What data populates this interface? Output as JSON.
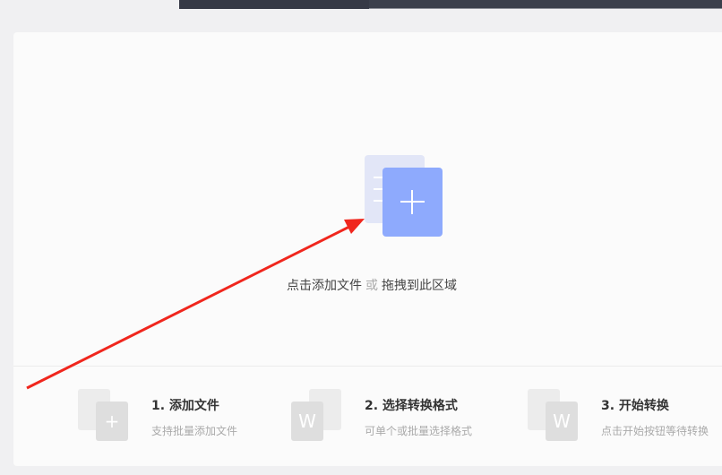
{
  "upload": {
    "hint_main": "点击添加文件",
    "hint_or": "或",
    "hint_drag": "拖拽到此区域"
  },
  "steps": [
    {
      "title": "1. 添加文件",
      "desc": "支持批量添加文件",
      "glyph": "+"
    },
    {
      "title": "2. 选择转换格式",
      "desc": "可单个或批量选择格式",
      "glyph": "W"
    },
    {
      "title": "3. 开始转换",
      "desc": "点击开始按钮等待转换",
      "glyph": "W"
    }
  ],
  "colors": {
    "accent": "#8eaafd",
    "arrow": "#f0261d"
  }
}
